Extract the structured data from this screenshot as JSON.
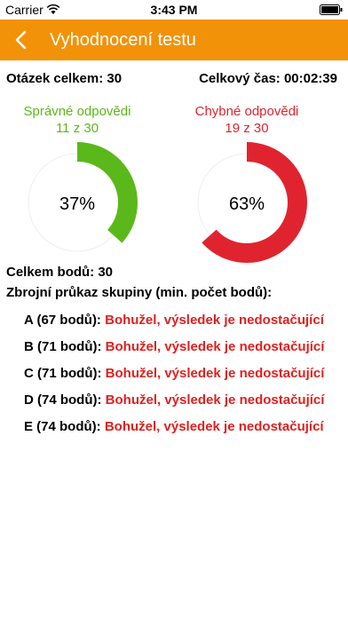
{
  "status_bar": {
    "carrier": "Carrier",
    "time": "3:43 PM"
  },
  "nav": {
    "title": "Vyhodnocení testu"
  },
  "summary": {
    "questions_total": "Otázek celkem: 30",
    "total_time": "Celkový čas: 00:02:39"
  },
  "correct": {
    "label": "Správné odpovědi",
    "count_text": "11 z 30",
    "percent_text": "37%",
    "fraction": 0.3667,
    "color": "#5bb81a"
  },
  "wrong": {
    "label": "Chybné odpovědi",
    "count_text": "19 z 30",
    "percent_text": "63%",
    "fraction": 0.6333,
    "color": "#e0242f"
  },
  "points": {
    "total": "Celkem bodů: 30"
  },
  "groups": {
    "title": "Zbrojní průkaz skupiny (min. počet bodů):",
    "items": [
      {
        "label": "A (67 bodů):",
        "result": "Bohužel, výsledek je nedostačující"
      },
      {
        "label": "B (71 bodů):",
        "result": "Bohužel, výsledek je nedostačující"
      },
      {
        "label": "C (71 bodů):",
        "result": "Bohužel, výsledek je nedostačující"
      },
      {
        "label": "D (74 bodů):",
        "result": "Bohužel, výsledek je nedostačující"
      },
      {
        "label": "E (74 bodů):",
        "result": "Bohužel, výsledek je nedostačující"
      }
    ]
  },
  "colors": {
    "nav_bg": "#f29208",
    "error_text": "#e02020"
  }
}
